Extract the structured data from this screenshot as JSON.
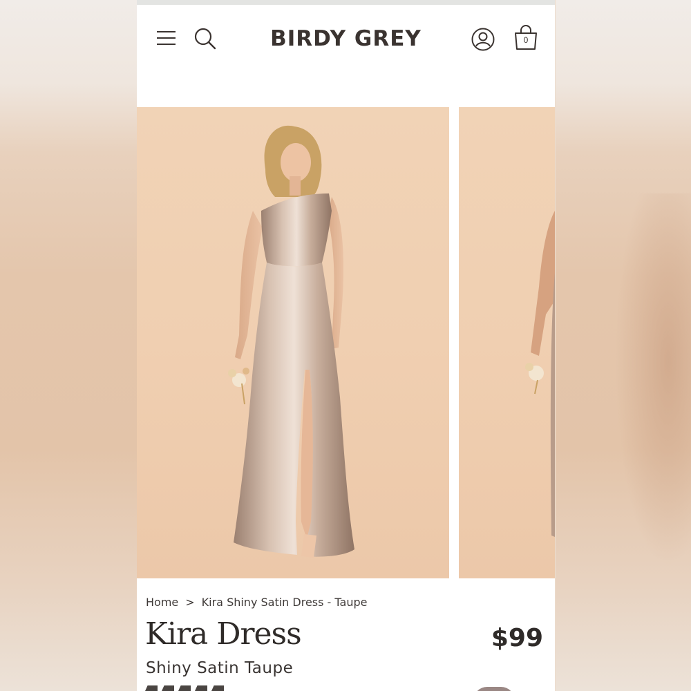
{
  "header": {
    "logo": "BIRDY GREY",
    "menu_icon": "hamburger-menu-icon",
    "search_icon": "search-icon",
    "account_icon": "user-account-icon",
    "cart_icon": "shopping-bag-icon",
    "cart_count": "0"
  },
  "gallery": {
    "images": [
      {
        "name": "kira-dress-front-photo"
      },
      {
        "name": "kira-dress-side-photo"
      }
    ]
  },
  "breadcrumb": {
    "home": "Home",
    "separator": ">",
    "current": "Kira Shiny Satin Dress - Taupe"
  },
  "product": {
    "title": "Kira Dress",
    "subtitle": "Shiny Satin Taupe",
    "price": "$99"
  },
  "colors": {
    "brand_text": "#3a3330",
    "background_photo": "#f0cfb1",
    "dress": "#b89c8a"
  }
}
